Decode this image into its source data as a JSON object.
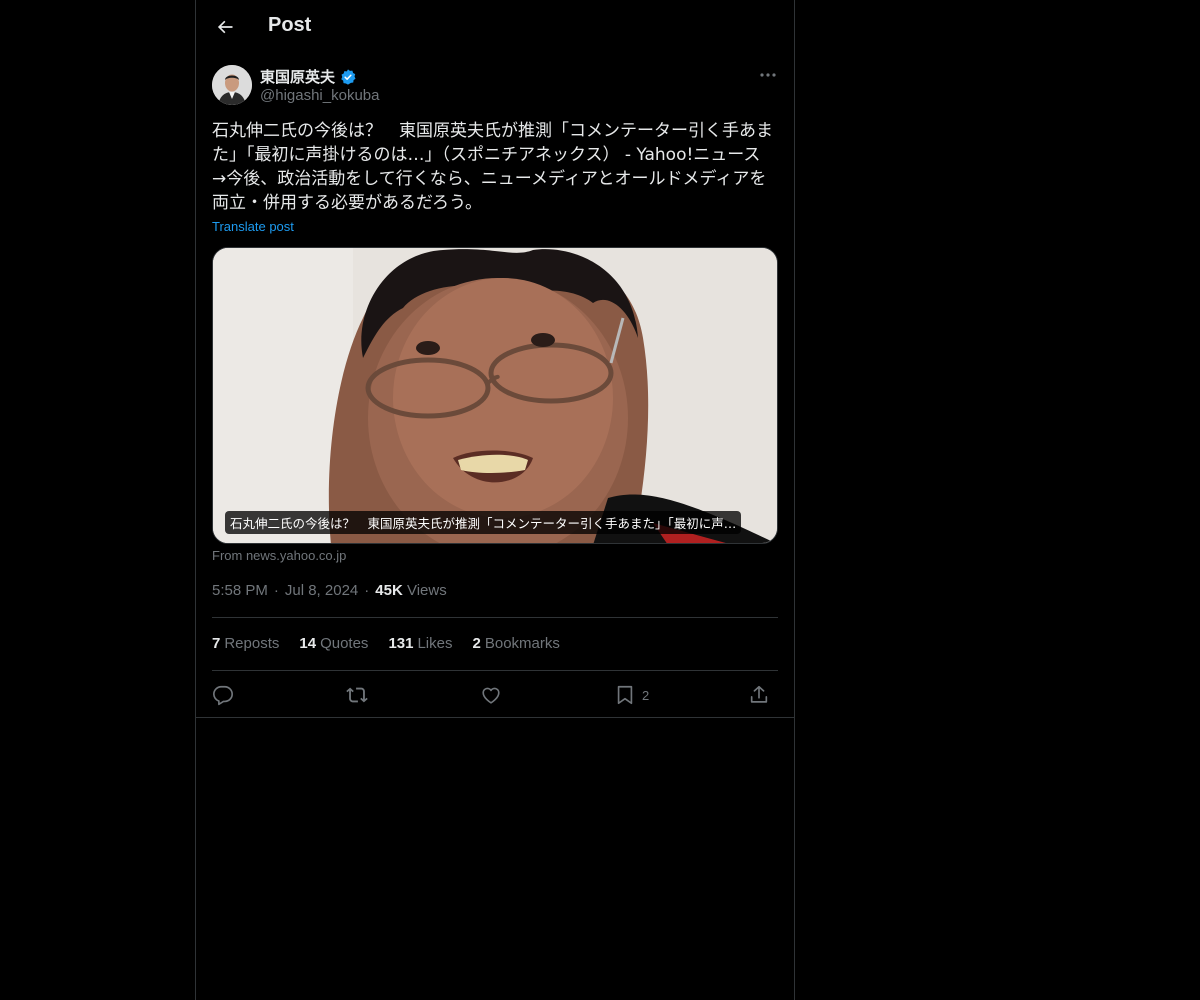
{
  "header": {
    "title": "Post",
    "back_icon": "arrow-left-icon"
  },
  "author": {
    "name": "東国原英夫",
    "handle": "@higashi_kokuba",
    "verified_icon": "verified-badge-icon",
    "verified_color": "#1d9bf0"
  },
  "post": {
    "text": "石丸伸二氏の今後は？　東国原英夫氏が推測「コメンテーター引く手あまた」「最初に声掛けるのは…」（スポニチアネックス） - Yahoo!ニュース\n→今後、政治活動をして行くなら、ニューメディアとオールドメディアを両立・併用する必要があるだろう。",
    "translate_label": "Translate post"
  },
  "card": {
    "caption": "石丸伸二氏の今後は？　東国原英夫氏が推測「コメンテーター引く手あまた」「最初に声…",
    "source": "From news.yahoo.co.jp"
  },
  "meta": {
    "time": "5:58 PM",
    "separator": "·",
    "date": "Jul 8, 2024",
    "views_count": "45K",
    "views_label": "Views"
  },
  "stats": [
    {
      "count": "7",
      "label": "Reposts"
    },
    {
      "count": "14",
      "label": "Quotes"
    },
    {
      "count": "131",
      "label": "Likes"
    },
    {
      "count": "2",
      "label": "Bookmarks"
    }
  ],
  "actions": {
    "reply_icon": "reply-icon",
    "repost_icon": "repost-icon",
    "like_icon": "heart-icon",
    "bookmark_icon": "bookmark-icon",
    "bookmark_count": "2",
    "share_icon": "share-icon"
  },
  "colors": {
    "background": "#000000",
    "text": "#e7e9ea",
    "muted": "#71767b",
    "accent": "#1d9bf0",
    "border": "#2f3336"
  }
}
